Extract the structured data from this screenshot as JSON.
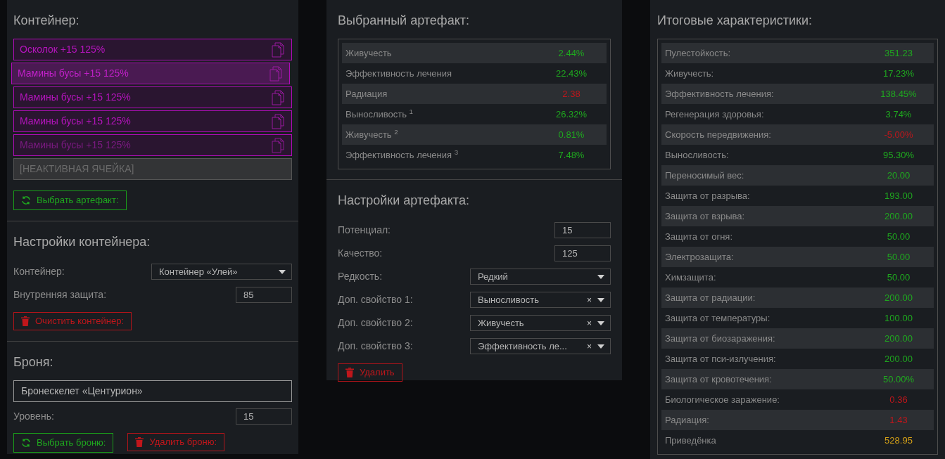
{
  "container": {
    "title": "Контейнер:",
    "slots": [
      {
        "kind": "artifact",
        "label": "Осколок +15 125%",
        "selected": false,
        "dimmed": false
      },
      {
        "kind": "artifact",
        "label": "Мамины бусы +15 125%",
        "selected": true,
        "dimmed": false
      },
      {
        "kind": "artifact",
        "label": "Мамины бусы +15 125%",
        "selected": false,
        "dimmed": false
      },
      {
        "kind": "artifact",
        "label": "Мамины бусы +15 125%",
        "selected": false,
        "dimmed": false
      },
      {
        "kind": "artifact",
        "label": "Мамины бусы +15 125%",
        "selected": false,
        "dimmed": true
      },
      {
        "kind": "inactive",
        "label": "[НЕАКТИВНАЯ ЯЧЕЙКА]"
      }
    ],
    "pick_button": "Выбрать артефакт:"
  },
  "container_settings": {
    "title": "Настройки контейнера:",
    "fields": [
      {
        "kind": "select",
        "label": "Контейнер:",
        "value": "Контейнер «Улей»"
      },
      {
        "kind": "number",
        "label": "Внутренняя защита:",
        "value": "85"
      }
    ],
    "clear_button": "Очистить контейнер:"
  },
  "armor": {
    "title": "Броня:",
    "name": "Бронескелет «Центурион»",
    "fields": [
      {
        "kind": "number",
        "label": "Уровень:",
        "value": "15"
      }
    ],
    "pick_button": "Выбрать броню:",
    "delete_button": "Удалить броню:"
  },
  "selected_artifact": {
    "title": "Выбранный артефакт:",
    "stats": [
      {
        "label": "Живучесть",
        "value": "2.44%",
        "color": "#1fa81f"
      },
      {
        "label": "Эффективность лечения",
        "value": "22.43%",
        "color": "#1fa81f"
      },
      {
        "label": "Радиация",
        "value": "2.38",
        "color": "#c0161b"
      },
      {
        "label": "Выносливость $^{1}$",
        "value": "26.32%",
        "color": "#1fa81f"
      },
      {
        "label": "Живучесть $^{2}$",
        "value": "0.81%",
        "color": "#1fa81f"
      },
      {
        "label": "Эффективность лечения $^{3}$",
        "value": "7.48%",
        "color": "#1fa81f"
      }
    ]
  },
  "artifact_settings": {
    "title": "Настройки артефакта:",
    "fields": [
      {
        "kind": "number",
        "label": "Потенциал:",
        "value": "15"
      },
      {
        "kind": "number",
        "label": "Качество:",
        "value": "125"
      },
      {
        "kind": "select",
        "label": "Редкость:",
        "value": "Редкий"
      },
      {
        "kind": "select",
        "label": "Доп. свойство 1:",
        "value": "Выносливость",
        "clear": "×"
      },
      {
        "kind": "select",
        "label": "Доп. свойство 2:",
        "value": "Живучесть",
        "clear": "×"
      },
      {
        "kind": "select",
        "label": "Доп. свойство 3:",
        "value": "Эффективность ле...",
        "clear": "×"
      }
    ],
    "delete_button": "Удалить"
  },
  "totals": {
    "title": "Итоговые характеристики:",
    "stats": [
      {
        "label": "Пулестойкость:",
        "value": "351.23",
        "color": "#1fa81f"
      },
      {
        "label": "Живучесть:",
        "value": "17.23%",
        "color": "#1fa81f"
      },
      {
        "label": "Эффективность лечения:",
        "value": "138.45%",
        "color": "#1fa81f"
      },
      {
        "label": "Регенерация здоровья:",
        "value": "3.74%",
        "color": "#1fa81f"
      },
      {
        "label": "Скорость передвижения:",
        "value": "-5.00%",
        "color": "#c0161b"
      },
      {
        "label": "Выносливость:",
        "value": "95.30%",
        "color": "#1fa81f"
      },
      {
        "label": "Переносимый вес:",
        "value": "20.00",
        "color": "#1fa81f"
      },
      {
        "label": "Защита от разрыва:",
        "value": "193.00",
        "color": "#1fa81f"
      },
      {
        "label": "Защита от взрыва:",
        "value": "200.00",
        "color": "#1fa81f"
      },
      {
        "label": "Защита от огня:",
        "value": "50.00",
        "color": "#1fa81f"
      },
      {
        "label": "Электрозащита:",
        "value": "50.00",
        "color": "#1fa81f"
      },
      {
        "label": "Химзащита:",
        "value": "50.00",
        "color": "#1fa81f"
      },
      {
        "label": "Защита от радиации:",
        "value": "200.00",
        "color": "#1fa81f"
      },
      {
        "label": "Защита от температуры:",
        "value": "100.00",
        "color": "#1fa81f"
      },
      {
        "label": "Защита от биозаражения:",
        "value": "200.00",
        "color": "#1fa81f"
      },
      {
        "label": "Защита от пси-излучения:",
        "value": "200.00",
        "color": "#1fa81f"
      },
      {
        "label": "Защита от кровотечения:",
        "value": "50.00%",
        "color": "#1fa81f"
      },
      {
        "label": "Биологическое заражение:",
        "value": "0.36",
        "color": "#c0161b"
      },
      {
        "label": "Радиация:",
        "value": "1.43",
        "color": "#c0161b"
      },
      {
        "label": "Приведёнка",
        "value": "528.95",
        "color": "#d4a017"
      }
    ]
  }
}
